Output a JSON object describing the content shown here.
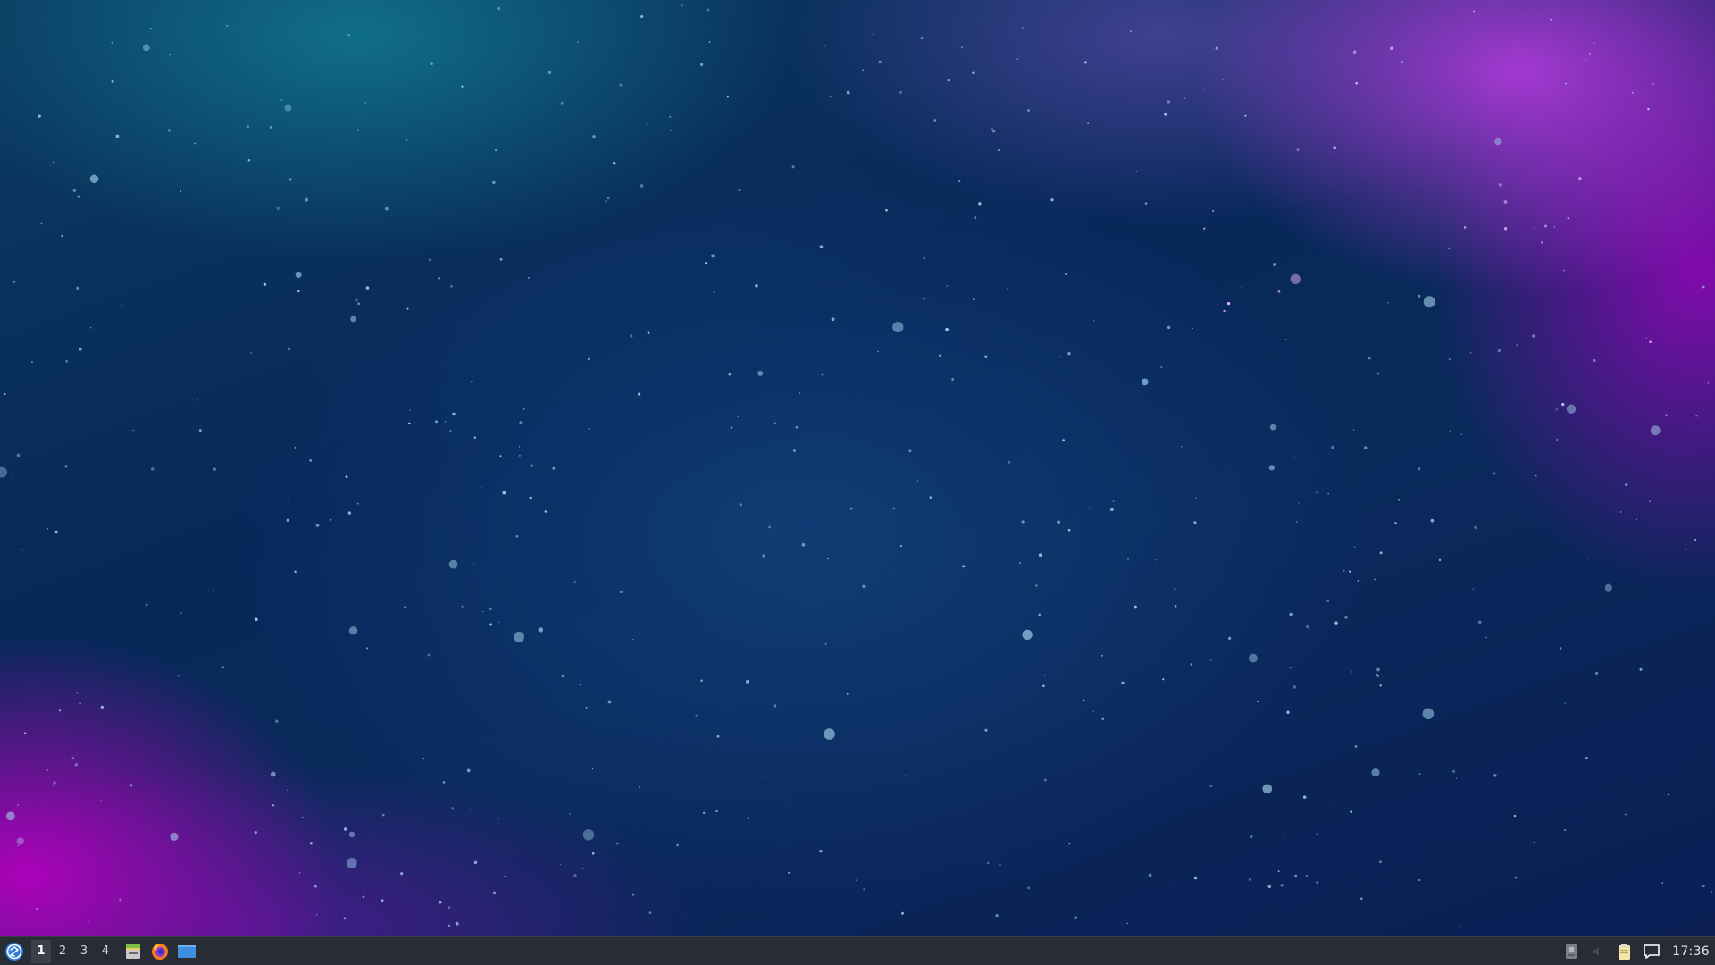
{
  "desktop": {
    "wallpaper": "space-nebula",
    "colors": {
      "base": "#0a2a5c",
      "teal": "#148ca0",
      "magenta": "#b400be",
      "violet": "#be3ce6"
    }
  },
  "taskbar": {
    "background": "#282c34",
    "menu_icon": "distro-logo-icon",
    "workspaces": [
      {
        "label": "1",
        "active": true
      },
      {
        "label": "2",
        "active": false
      },
      {
        "label": "3",
        "active": false
      },
      {
        "label": "4",
        "active": false
      }
    ],
    "launchers": [
      {
        "name": "file-manager-icon"
      },
      {
        "name": "firefox-icon"
      },
      {
        "name": "show-desktop-icon"
      }
    ],
    "tray": [
      {
        "name": "removable-drive-icon"
      },
      {
        "name": "volume-icon"
      },
      {
        "name": "clipboard-icon"
      },
      {
        "name": "notifications-icon"
      }
    ],
    "clock": "17:36"
  }
}
